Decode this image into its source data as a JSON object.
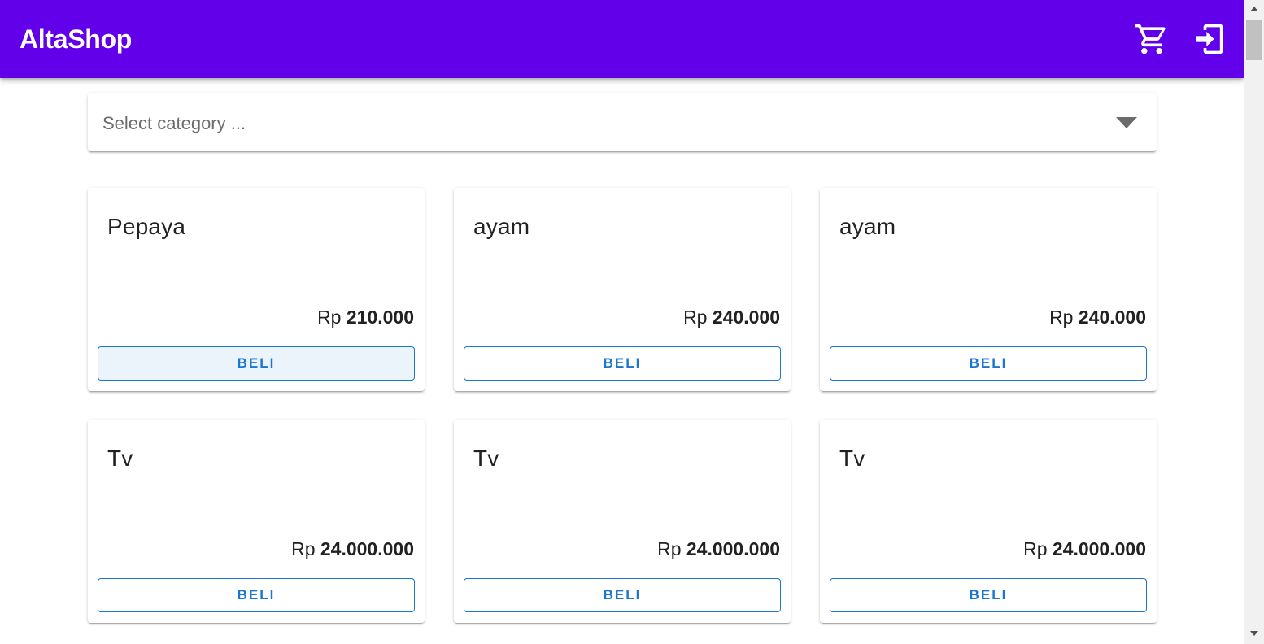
{
  "app": {
    "title": "AltaShop",
    "icons": {
      "cart": "cart-icon",
      "login": "login-icon"
    },
    "colors": {
      "appbar": "#6200ea",
      "accent": "#1976d2"
    }
  },
  "category_select": {
    "placeholder": "Select category ...",
    "icon": "chevron-down-icon"
  },
  "products": [
    {
      "name": "Pepaya",
      "currency": "Rp",
      "price": "210.000",
      "button": "BELI"
    },
    {
      "name": "ayam",
      "currency": "Rp",
      "price": "240.000",
      "button": "BELI"
    },
    {
      "name": "ayam",
      "currency": "Rp",
      "price": "240.000",
      "button": "BELI"
    },
    {
      "name": "Tv",
      "currency": "Rp",
      "price": "24.000.000",
      "button": "BELI"
    },
    {
      "name": "Tv",
      "currency": "Rp",
      "price": "24.000.000",
      "button": "BELI"
    },
    {
      "name": "Tv",
      "currency": "Rp",
      "price": "24.000.000",
      "button": "BELI"
    }
  ]
}
